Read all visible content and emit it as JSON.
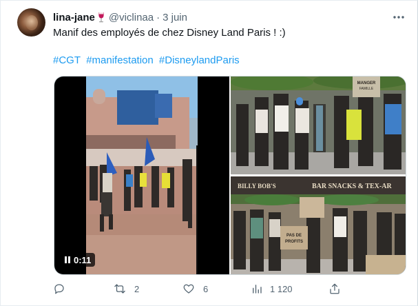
{
  "tweet": {
    "display_name": "lina-jane",
    "name_emoji": "wine-glass-icon",
    "handle": "@viclinaa",
    "separator": "·",
    "date": "3 juin",
    "text": "Manif des employés de chez Disney Land Paris ! :)",
    "hashtags": [
      "#CGT",
      "#manifestation",
      "#DisneylandParis"
    ]
  },
  "media": {
    "video_duration": "0:11",
    "video_state": "pause-icon",
    "photo2_banner": "BAR SNACKS & TEX-AR",
    "photo2_banner_left": "BILLY BOB'S",
    "sign_photo1": "MANGER FAMILLE A PEU",
    "sign_photo2": "PAS DE PROFITS"
  },
  "actions": {
    "reply_count": "",
    "retweet_count": "2",
    "like_count": "6",
    "views_count": "1 120"
  },
  "colors": {
    "accent": "#1d9bf0",
    "muted": "#536471",
    "text": "#0f1419"
  }
}
